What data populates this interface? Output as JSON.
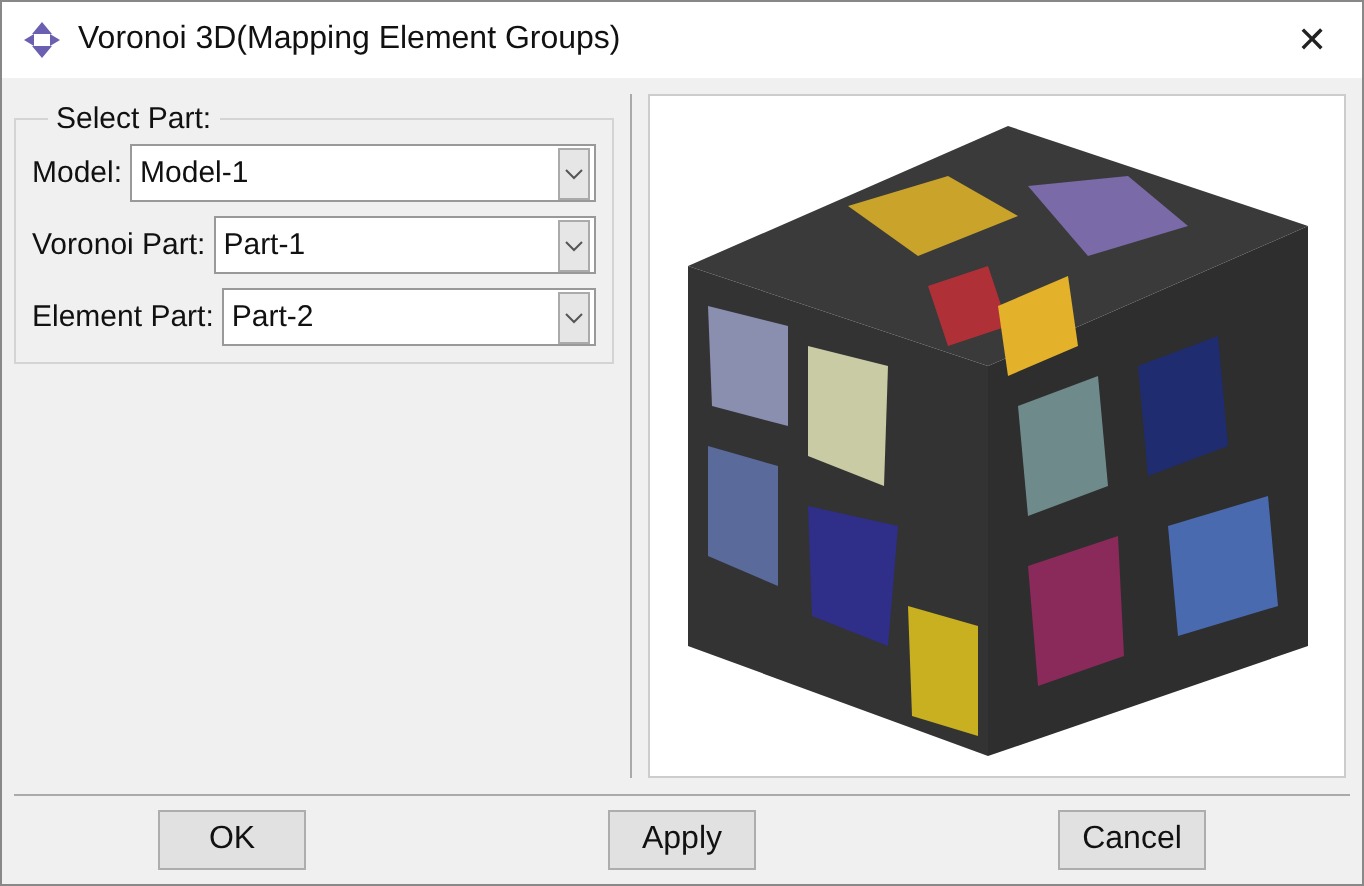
{
  "window": {
    "title": "Voronoi 3D(Mapping Element Groups)",
    "close": "✕"
  },
  "group": {
    "title": "Select Part:",
    "fields": [
      {
        "label": "Model:",
        "value": "Model-1"
      },
      {
        "label": "Voronoi Part:",
        "value": "Part-1"
      },
      {
        "label": "Element Part:",
        "value": "Part-2"
      }
    ]
  },
  "buttons": [
    "OK",
    "Apply",
    "Cancel"
  ]
}
